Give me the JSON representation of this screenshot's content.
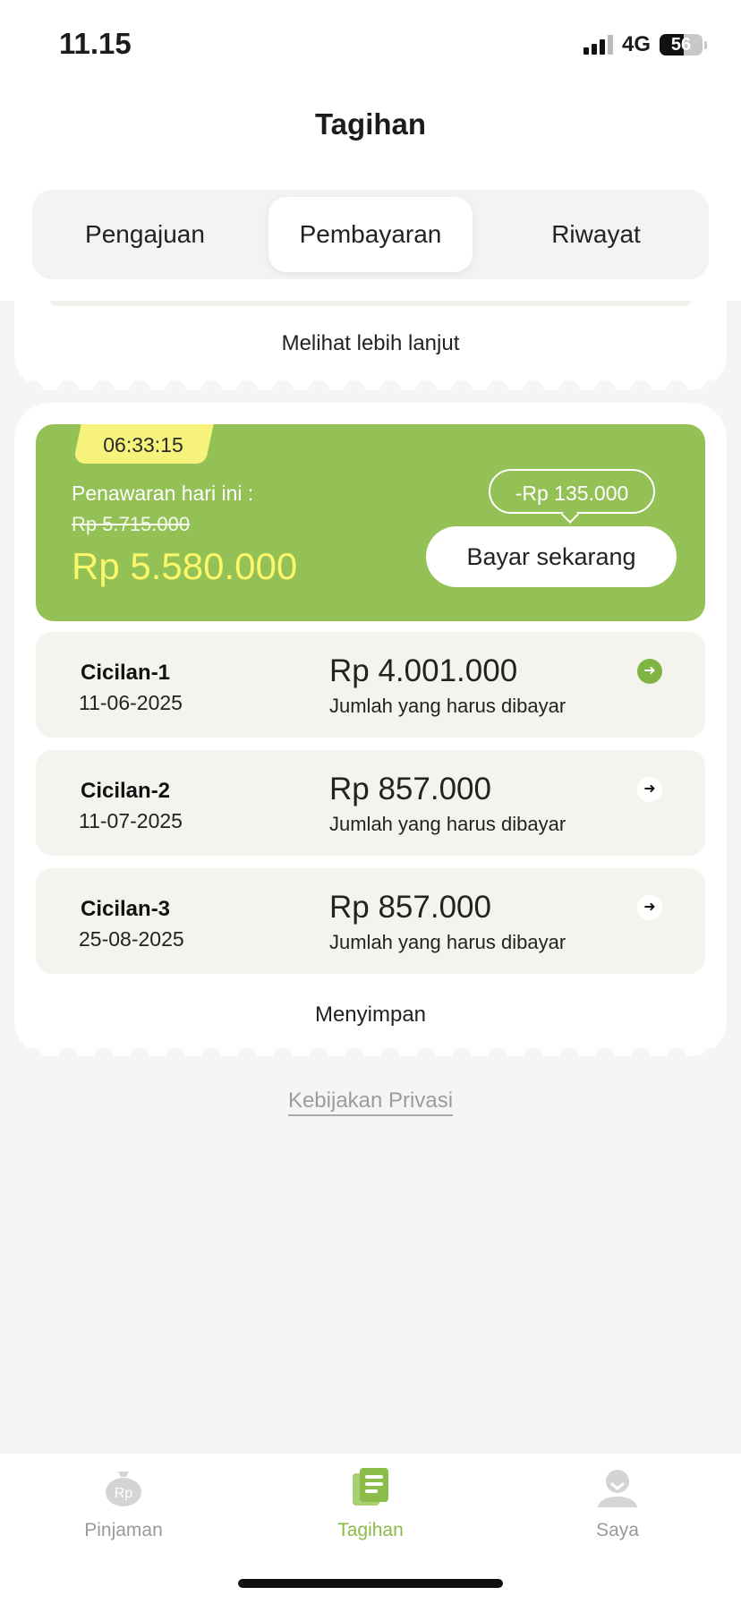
{
  "status_bar": {
    "time": "11.15",
    "network": "4G",
    "battery": "56"
  },
  "header": {
    "title": "Tagihan",
    "tabs": [
      {
        "label": "Pengajuan"
      },
      {
        "label": "Pembayaran"
      },
      {
        "label": "Riwayat"
      }
    ],
    "active_tab": "Pembayaran"
  },
  "previous_card": {
    "more_label": "Melihat lebih lanjut"
  },
  "offer": {
    "timer": "06:33:15",
    "label": "Penawaran hari ini :",
    "old_price": "Rp 5.715.000",
    "new_price": "Rp 5.580.000",
    "discount": "-Rp 135.000",
    "pay_button": "Bayar sekarang"
  },
  "installments": [
    {
      "name": "Cicilan-1",
      "date": "11-06-2025",
      "amount": "Rp 4.001.000",
      "note": "Jumlah yang harus dibayar"
    },
    {
      "name": "Cicilan-2",
      "date": "11-07-2025",
      "amount": "Rp 857.000",
      "note": "Jumlah yang harus dibayar"
    },
    {
      "name": "Cicilan-3",
      "date": "25-08-2025",
      "amount": "Rp 857.000",
      "note": "Jumlah yang harus dibayar"
    }
  ],
  "save_label": "Menyimpan",
  "privacy_link": "Kebijakan Privasi",
  "bottom_nav": {
    "items": [
      {
        "label": "Pinjaman",
        "icon": "money-bag-icon"
      },
      {
        "label": "Tagihan",
        "icon": "bill-icon"
      },
      {
        "label": "Saya",
        "icon": "person-icon"
      }
    ],
    "active": "Tagihan",
    "loan_icon_text": "Rp"
  },
  "colors": {
    "accent_green": "#94c156",
    "nav_active": "#8bbb48",
    "highlight_yellow": "#fbf66a",
    "timer_yellow": "#f6f27c"
  }
}
